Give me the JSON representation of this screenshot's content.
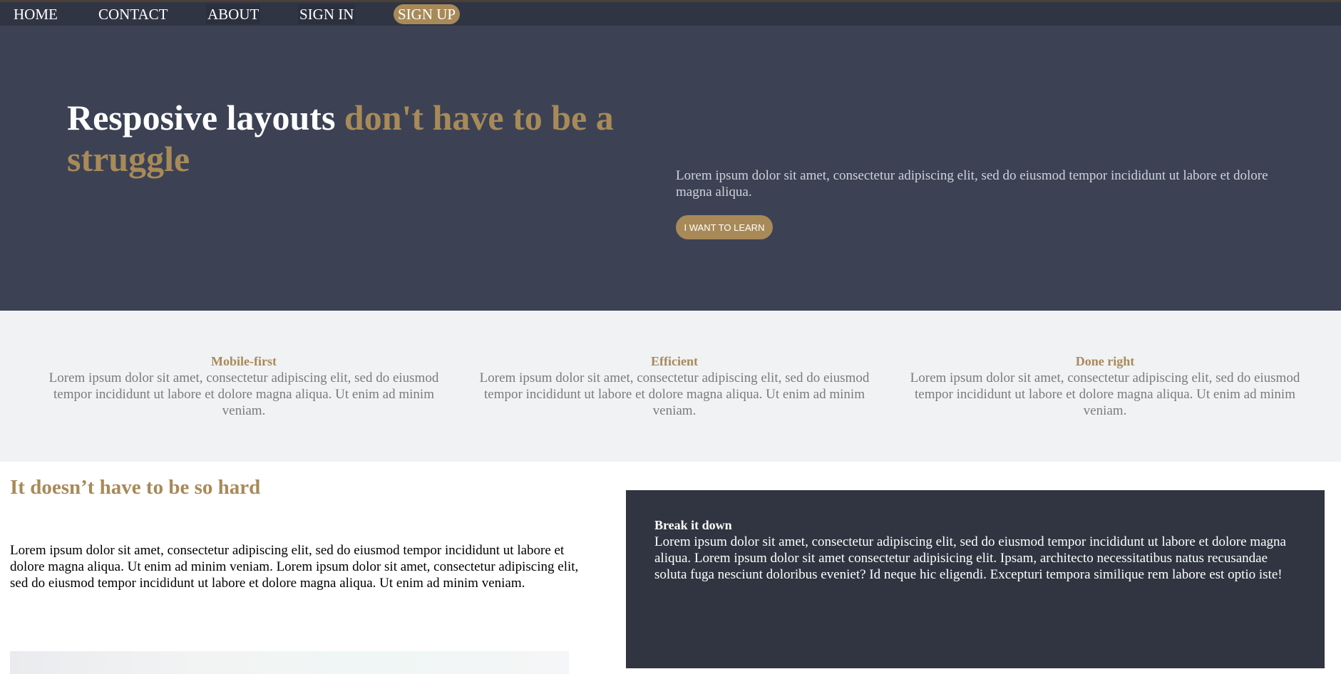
{
  "nav": {
    "home": "HOME",
    "contact": "CONTACT",
    "about": "ABOUT",
    "sign_in": "SIGN IN",
    "sign_up": "SIGN UP"
  },
  "hero": {
    "title_white": "Resposive layouts ",
    "title_accent": "don't have to be a struggle",
    "text": "Lorem ipsum dolor sit amet, consectetur adipiscing elit, sed do eiusmod tempor incididunt ut labore et dolore magna aliqua.",
    "button": "I WANT TO LEARN"
  },
  "features": [
    {
      "title": "Mobile-first",
      "text": "Lorem ipsum dolor sit amet, consectetur adipiscing elit, sed do eiusmod tempor incididunt ut labore et dolore magna aliqua. Ut enim ad minim veniam."
    },
    {
      "title": "Efficient",
      "text": "Lorem ipsum dolor sit amet, consectetur adipiscing elit, sed do eiusmod tempor incididunt ut labore et dolore magna aliqua. Ut enim ad minim veniam."
    },
    {
      "title": "Done right",
      "text": "Lorem ipsum dolor sit amet, consectetur adipiscing elit, sed do eiusmod tempor incididunt ut labore et dolore magna aliqua. Ut enim ad minim veniam."
    }
  ],
  "section": {
    "heading": "It doesn’t have to be so hard",
    "text": "Lorem ipsum dolor sit amet, consectetur adipiscing elit, sed do eiusmod tempor incididunt ut labore et dolore magna aliqua. Ut enim ad minim veniam. Lorem ipsum dolor sit amet, consectetur adipiscing elit, sed do eiusmod tempor incididunt ut labore et dolore magna aliqua. Ut enim ad minim veniam."
  },
  "card": {
    "title": "Break it down",
    "text": "Lorem ipsum dolor sit amet, consectetur adipiscing elit, sed do eiusmod tempor incididunt ut labore et dolore magna aliqua. Lorem ipsum dolor sit amet consectetur adipisicing elit. Ipsam, architecto necessitatibus natus recusandae soluta fuga nesciunt doloribus eveniet? Id neque hic eligendi. Excepturi tempora similique rem labore est optio iste!"
  },
  "colors": {
    "accent": "#a88a58",
    "hero_bg": "#3c4254",
    "nav_bg": "#303544",
    "card_bg": "#303541",
    "features_bg": "#f1f2f4"
  }
}
